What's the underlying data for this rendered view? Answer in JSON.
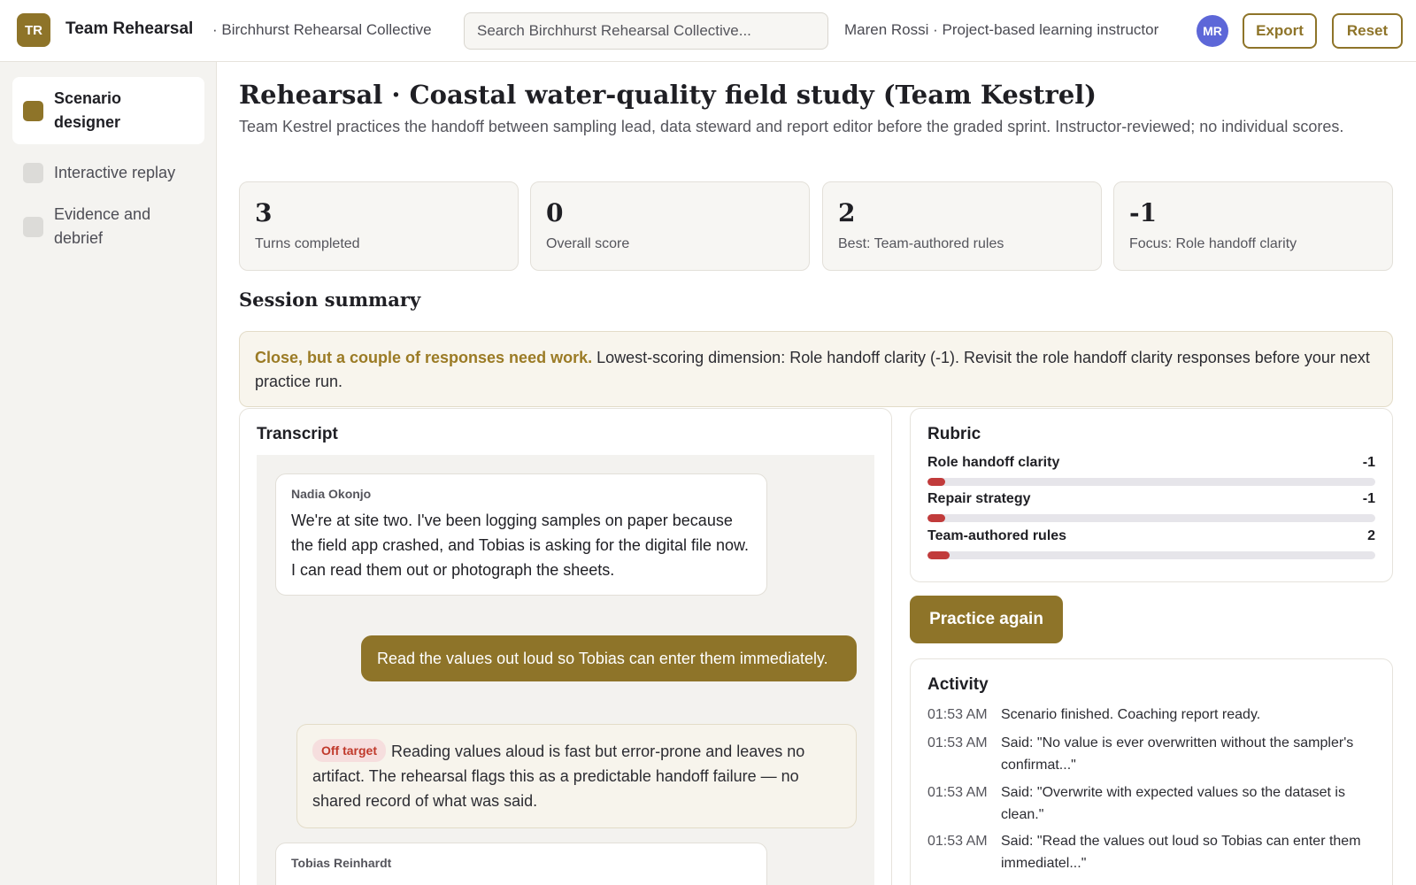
{
  "header": {
    "logo_initials": "TR",
    "app_title": "Team Rehearsal",
    "org_name": "· Birchhurst Rehearsal Collective",
    "search_placeholder": "Search Birchhurst Rehearsal Collective...",
    "user_text": "Maren Rossi · Project-based learning instructor",
    "avatar_initials": "MR",
    "export_label": "Export",
    "reset_label": "Reset"
  },
  "sidebar": {
    "items": [
      {
        "label": "Scenario designer",
        "active": true
      },
      {
        "label": "Interactive replay",
        "active": false
      },
      {
        "label": "Evidence and debrief",
        "active": false
      }
    ]
  },
  "page": {
    "title": "Rehearsal · Coastal water-quality field study (Team Kestrel)",
    "subtitle": "Team Kestrel practices the handoff between sampling lead, data steward and report editor before the graded sprint. Instructor-reviewed; no individual scores."
  },
  "stats": [
    {
      "value": "3",
      "label": "Turns completed"
    },
    {
      "value": "0",
      "label": "Overall score"
    },
    {
      "value": "2",
      "label": "Best: Team-authored rules"
    },
    {
      "value": "-1",
      "label": "Focus: Role handoff clarity"
    }
  ],
  "summary": {
    "heading": "Session summary",
    "strong": "Close, but a couple of responses need work.",
    "text": " Lowest-scoring dimension: Role handoff clarity (-1). Revisit the role handoff clarity responses before your next practice run."
  },
  "transcript": {
    "title": "Transcript",
    "messages": [
      {
        "author": "Nadia Okonjo",
        "text": "We're at site two. I've been logging samples on paper because the field app crashed, and Tobias is asking for the digital file now. I can read them out or photograph the sheets."
      },
      {
        "self_text": "Read the values out loud so Tobias can enter them immediately."
      },
      {
        "tag": "Off target",
        "feedback": "Reading values aloud is fast but error-prone and leaves no artifact. The rehearsal flags this as a predictable handoff failure — no shared record of what was said."
      },
      {
        "author": "Tobias Reinhardt"
      }
    ]
  },
  "rubric": {
    "title": "Rubric",
    "items": [
      {
        "name": "Role handoff clarity",
        "value": "-1",
        "fill": 0.04
      },
      {
        "name": "Repair strategy",
        "value": "-1",
        "fill": 0.04
      },
      {
        "name": "Team-authored rules",
        "value": "2",
        "fill": 0.05
      }
    ],
    "bar_color": "#c13b3b"
  },
  "practice_again_label": "Practice again",
  "activity": {
    "title": "Activity",
    "items": [
      {
        "time": "01:53 AM",
        "text": "Scenario finished. Coaching report ready."
      },
      {
        "time": "01:53 AM",
        "text": "Said: \"No value is ever overwritten without the sampler's confirmat...\""
      },
      {
        "time": "01:53 AM",
        "text": "Said: \"Overwrite with expected values so the dataset is clean.\""
      },
      {
        "time": "01:53 AM",
        "text": "Said: \"Read the values out loud so Tobias can enter them immediatel...\""
      }
    ]
  },
  "colors": {
    "accent": "#8e7429",
    "avatar": "#5d67d8",
    "off_target": "#c0392b"
  }
}
